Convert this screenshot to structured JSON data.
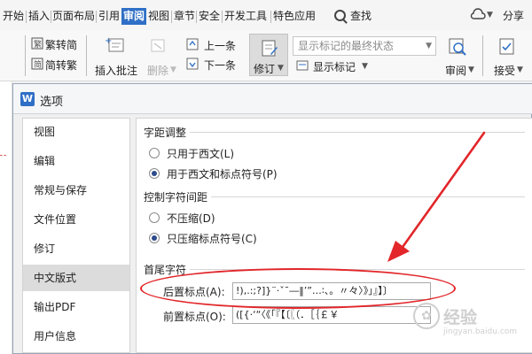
{
  "menubar": {
    "items": [
      "开始",
      "插入",
      "页面布局",
      "引用",
      "审阅",
      "视图",
      "章节",
      "安全",
      "开发工具",
      "特色应用"
    ],
    "search": "查找",
    "share": "分享"
  },
  "toolbar": {
    "trad_to_simp": "繁转简",
    "simp_to_trad": "简转繁",
    "insert_comment": "插入批注",
    "delete": "删除",
    "prev_item": "上一条",
    "next_item": "下一条",
    "revise": "修订",
    "status_value": "显示标记的最终状态",
    "show_marks": "显示标记",
    "review": "审阅",
    "accept": "接受"
  },
  "dialog": {
    "title": "选项",
    "nav_items": [
      "视图",
      "编辑",
      "常规与保存",
      "文件位置",
      "修订",
      "中文版式",
      "输出PDF",
      "用户信息"
    ],
    "selected_nav": "中文版式",
    "sections": {
      "spacing": {
        "title": "字距调整",
        "options": [
          "只用于西文(L)",
          "用于西文和标点符号(P)"
        ],
        "selected_index": 1
      },
      "char_spacing": {
        "title": "控制字符间距",
        "options": [
          "不压缩(D)",
          "只压缩标点符号(C)"
        ],
        "selected_index": 1
      },
      "first_last": {
        "title": "首尾字符",
        "trailing_label": "后置标点(A):",
        "trailing_value": "!),.:;?]}¨·ˇˉ―‖’”…∶、。〃々〉》」』】〕",
        "leading_label": "前置标点(O):",
        "leading_value": "([{·‘“〈《「『【〔〖（．［｛￡￥"
      }
    }
  },
  "watermark": {
    "text": "经验",
    "url": "jingyan.baidu.com"
  },
  "colors": {
    "accent_blue": "#2f6fc6",
    "annotation_red": "#e2262a",
    "nav_selected": "#dcdcdc"
  }
}
